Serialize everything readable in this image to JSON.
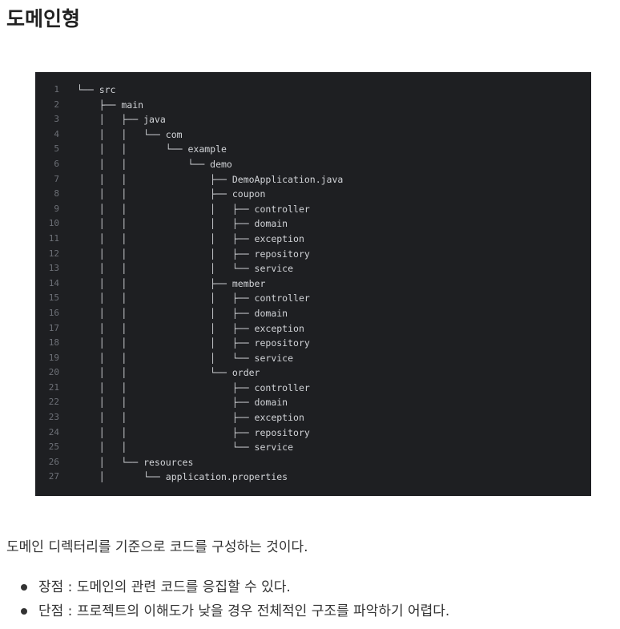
{
  "heading": "도메인형",
  "code_lines": [
    "└── src",
    "    ├── main",
    "    │   ├── java",
    "    │   │   └── com",
    "    │   │       └── example",
    "    │   │           └── demo",
    "    │   │               ├── DemoApplication.java",
    "    │   │               ├── coupon",
    "    │   │               │   ├── controller",
    "    │   │               │   ├── domain",
    "    │   │               │   ├── exception",
    "    │   │               │   ├── repository",
    "    │   │               │   └── service",
    "    │   │               ├── member",
    "    │   │               │   ├── controller",
    "    │   │               │   ├── domain",
    "    │   │               │   ├── exception",
    "    │   │               │   ├── repository",
    "    │   │               │   └── service",
    "    │   │               └── order",
    "    │   │                   ├── controller",
    "    │   │                   ├── domain",
    "    │   │                   ├── exception",
    "    │   │                   ├── repository",
    "    │   │                   └── service",
    "    │   └── resources",
    "    │       └── application.properties"
  ],
  "paragraph": "도메인 디렉터리를 기준으로 코드를 구성하는 것이다.",
  "bullets": [
    "장점 : 도메인의 관련 코드를 응집할 수 있다.",
    "단점 : 프로젝트의 이해도가 낮을 경우 전체적인 구조를 파악하기 어렵다."
  ],
  "colors": {
    "code_background": "#1e1f22",
    "code_text": "#d2d4d8",
    "line_number": "#6d7077",
    "tree_accent": "#3c9a7a"
  }
}
